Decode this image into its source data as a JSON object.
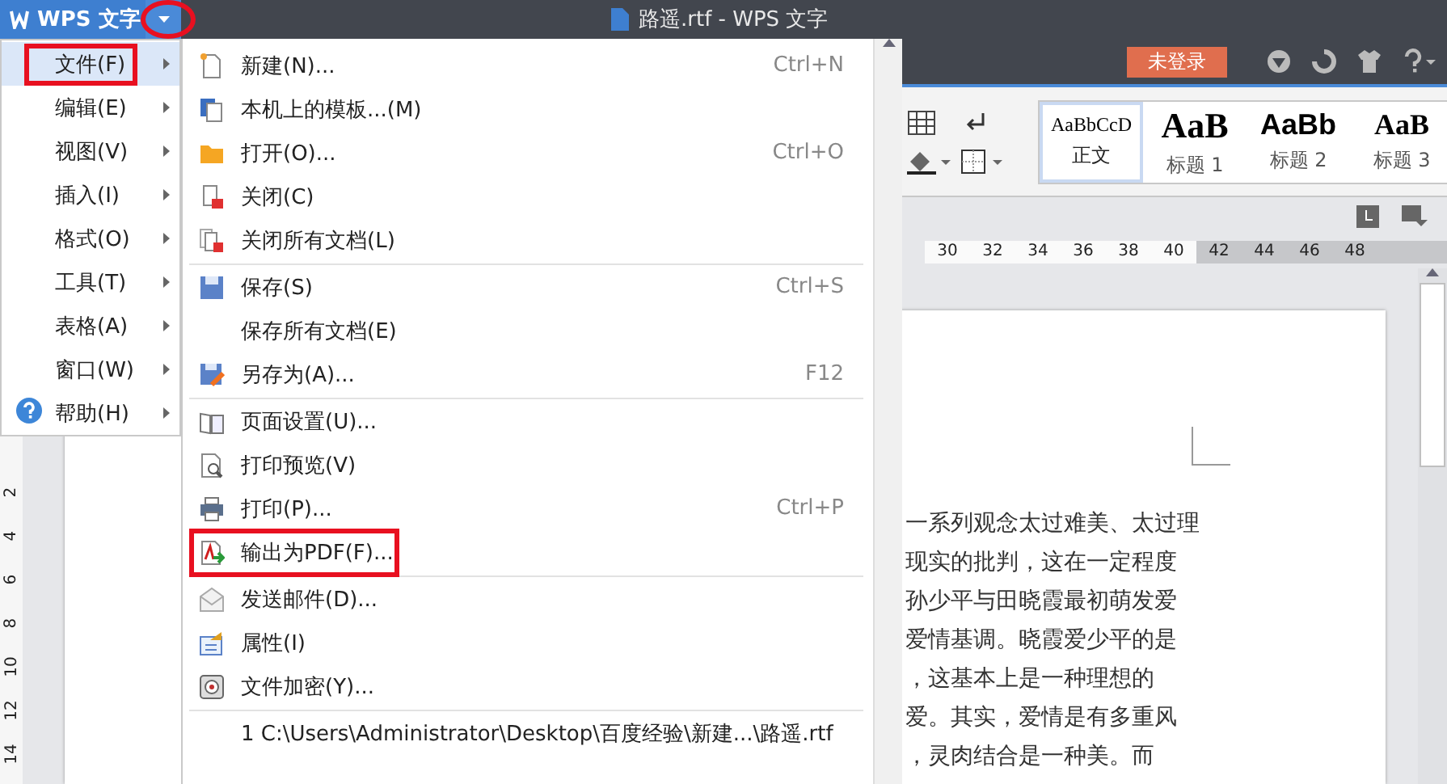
{
  "title_bar": {
    "app_button": "WPS 文字",
    "menu_arrow_annotated": true,
    "document_title": "路遥.rtf - WPS 文字",
    "login_button": "未登录"
  },
  "main_menu": [
    {
      "label": "文件(F)",
      "selected": true,
      "annotated": true,
      "kind": "plain"
    },
    {
      "label": "编辑(E)",
      "selected": false,
      "annotated": false,
      "kind": "plain"
    },
    {
      "label": "视图(V)",
      "selected": false,
      "annotated": false,
      "kind": "plain"
    },
    {
      "label": "插入(I)",
      "selected": false,
      "annotated": false,
      "kind": "plain"
    },
    {
      "label": "格式(O)",
      "selected": false,
      "annotated": false,
      "kind": "plain"
    },
    {
      "label": "工具(T)",
      "selected": false,
      "annotated": false,
      "kind": "plain"
    },
    {
      "label": "表格(A)",
      "selected": false,
      "annotated": false,
      "kind": "plain"
    },
    {
      "label": "窗口(W)",
      "selected": false,
      "annotated": false,
      "kind": "plain"
    },
    {
      "label": "帮助(H)",
      "selected": false,
      "annotated": false,
      "kind": "help"
    }
  ],
  "file_menu": [
    [
      {
        "label": "新建(N)...",
        "shortcut": "Ctrl+N",
        "kind": "new",
        "annotated": false
      },
      {
        "label": "本机上的模板...(M)",
        "kind": "template",
        "annotated": false
      },
      {
        "label": "打开(O)...",
        "shortcut": "Ctrl+O",
        "kind": "open",
        "annotated": false
      },
      {
        "label": "关闭(C)",
        "kind": "close",
        "annotated": false
      },
      {
        "label": "关闭所有文档(L)",
        "kind": "close_all",
        "annotated": false
      }
    ],
    [
      {
        "label": "保存(S)",
        "shortcut": "Ctrl+S",
        "kind": "save",
        "annotated": false
      },
      {
        "label": "保存所有文档(E)",
        "kind": "none",
        "annotated": false
      },
      {
        "label": "另存为(A)...",
        "shortcut": "F12",
        "kind": "save_as",
        "annotated": false
      }
    ],
    [
      {
        "label": "页面设置(U)...",
        "kind": "page_setup",
        "annotated": false
      },
      {
        "label": "打印预览(V)",
        "kind": "preview",
        "annotated": false
      },
      {
        "label": "打印(P)...",
        "shortcut": "Ctrl+P",
        "kind": "print",
        "annotated": false
      },
      {
        "label": "输出为PDF(F)...",
        "kind": "pdf",
        "annotated": true
      }
    ],
    [
      {
        "label": "发送邮件(D)...",
        "kind": "mail",
        "annotated": false
      },
      {
        "label": "属性(I)",
        "kind": "properties",
        "annotated": false
      },
      {
        "label": "文件加密(Y)...",
        "kind": "encrypt",
        "annotated": false
      }
    ],
    [
      {
        "label": "1 C:\\Users\\Administrator\\Desktop\\百度经验\\新建...\\路遥.rtf",
        "kind": "none",
        "annotated": false
      }
    ]
  ],
  "style_gallery": [
    {
      "preview": "AaBbCcD",
      "label": "正文",
      "selected": true,
      "kind": "body"
    },
    {
      "preview": "AaB",
      "label": "标题 1",
      "selected": false,
      "kind": "h1"
    },
    {
      "preview": "AaBb",
      "label": "标题 2",
      "selected": false,
      "kind": "h2"
    },
    {
      "preview": "AaB",
      "label": "标题 3",
      "selected": false,
      "kind": "h3"
    }
  ],
  "horizontal_ruler": [
    "30",
    "32",
    "34",
    "36",
    "38",
    "40",
    "42",
    "44",
    "46",
    "48"
  ],
  "vertical_ruler": [
    "2",
    "4",
    "6",
    "8",
    "10",
    "12",
    "14"
  ],
  "document_lines": [
    "一系列观念太过难美、太过理",
    "现实的批判，这在一定程度",
    "孙少平与田晓霞最初萌发爱",
    "爱情基调。晓霞爱少平的是",
    "，这基本上是一种理想的",
    "爱。其实，爱情是有多重风",
    "，灵肉结合是一种美。而"
  ]
}
